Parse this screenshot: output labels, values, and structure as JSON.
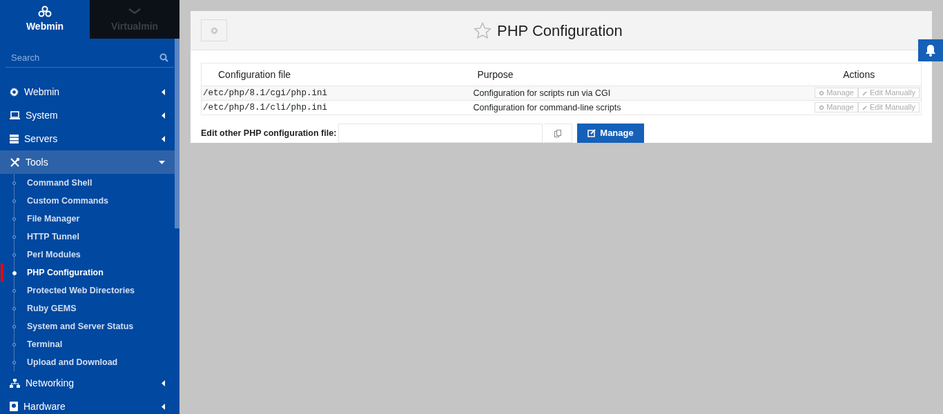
{
  "switcher": [
    {
      "label": "Webmin",
      "selected": true
    },
    {
      "label": "Virtualmin",
      "selected": false
    }
  ],
  "search": {
    "placeholder": "Search"
  },
  "menu": [
    {
      "label": "Webmin",
      "expanded": false
    },
    {
      "label": "System",
      "expanded": false
    },
    {
      "label": "Servers",
      "expanded": false
    },
    {
      "label": "Tools",
      "expanded": true,
      "children": [
        {
          "label": "Command Shell",
          "selected": false
        },
        {
          "label": "Custom Commands",
          "selected": false
        },
        {
          "label": "File Manager",
          "selected": false
        },
        {
          "label": "HTTP Tunnel",
          "selected": false
        },
        {
          "label": "Perl Modules",
          "selected": false
        },
        {
          "label": "PHP Configuration",
          "selected": true
        },
        {
          "label": "Protected Web Directories",
          "selected": false
        },
        {
          "label": "Ruby GEMS",
          "selected": false
        },
        {
          "label": "System and Server Status",
          "selected": false
        },
        {
          "label": "Terminal",
          "selected": false
        },
        {
          "label": "Upload and Download",
          "selected": false
        }
      ]
    },
    {
      "label": "Networking",
      "expanded": false
    },
    {
      "label": "Hardware",
      "expanded": false
    }
  ],
  "page": {
    "title": "PHP Configuration",
    "favorite": false
  },
  "table": {
    "columns": [
      "Configuration file",
      "Purpose",
      "Actions"
    ],
    "rows": [
      {
        "file": "/etc/php/8.1/cgi/php.ini",
        "purpose": "Configuration for scripts run via CGI",
        "actions": [
          "Manage",
          "Edit Manually"
        ]
      },
      {
        "file": "/etc/php/8.1/cli/php.ini",
        "purpose": "Configuration for command-line scripts",
        "actions": [
          "Manage",
          "Edit Manually"
        ]
      }
    ]
  },
  "other": {
    "label": "Edit other PHP configuration file:",
    "button": "Manage"
  }
}
